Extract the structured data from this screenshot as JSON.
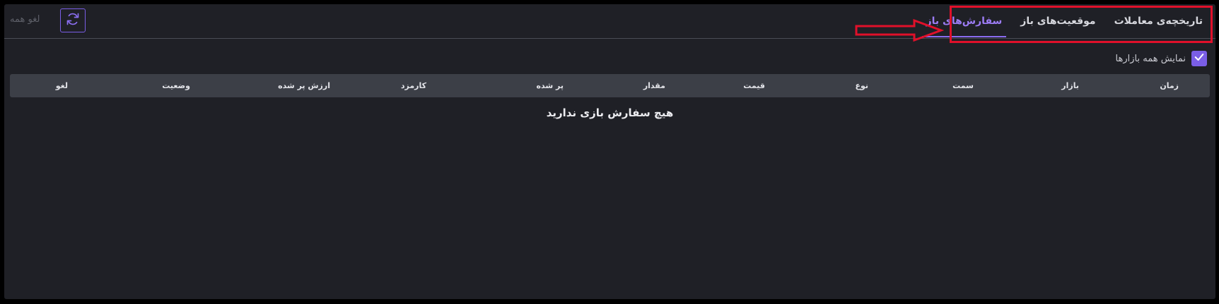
{
  "tabs": [
    {
      "label": "سفارش‌های باز",
      "active": true
    },
    {
      "label": "موقعیت‌های باز",
      "active": false
    },
    {
      "label": "تاریخچه‌ی معاملات",
      "active": false
    }
  ],
  "toolbar": {
    "cancel_all_label": "لغو همه",
    "refresh_icon": "refresh-icon"
  },
  "filter": {
    "show_all_markets_label": "نمایش همه بازارها",
    "show_all_markets_checked": true
  },
  "table": {
    "columns": [
      "زمان",
      "بازار",
      "سمت",
      "نوع",
      "قیمت",
      "مقدار",
      "پر شده",
      "کارمزد",
      "ارزش پر شده",
      "وضعیت",
      "لغو"
    ],
    "empty_message": "هیچ سفارش بازی ندارید"
  },
  "colors": {
    "accent": "#7a5ee6",
    "active_tab": "#9c7cf4",
    "annotation_red": "#e0102a",
    "background": "#1f2026",
    "table_header": "#3c3f47"
  }
}
